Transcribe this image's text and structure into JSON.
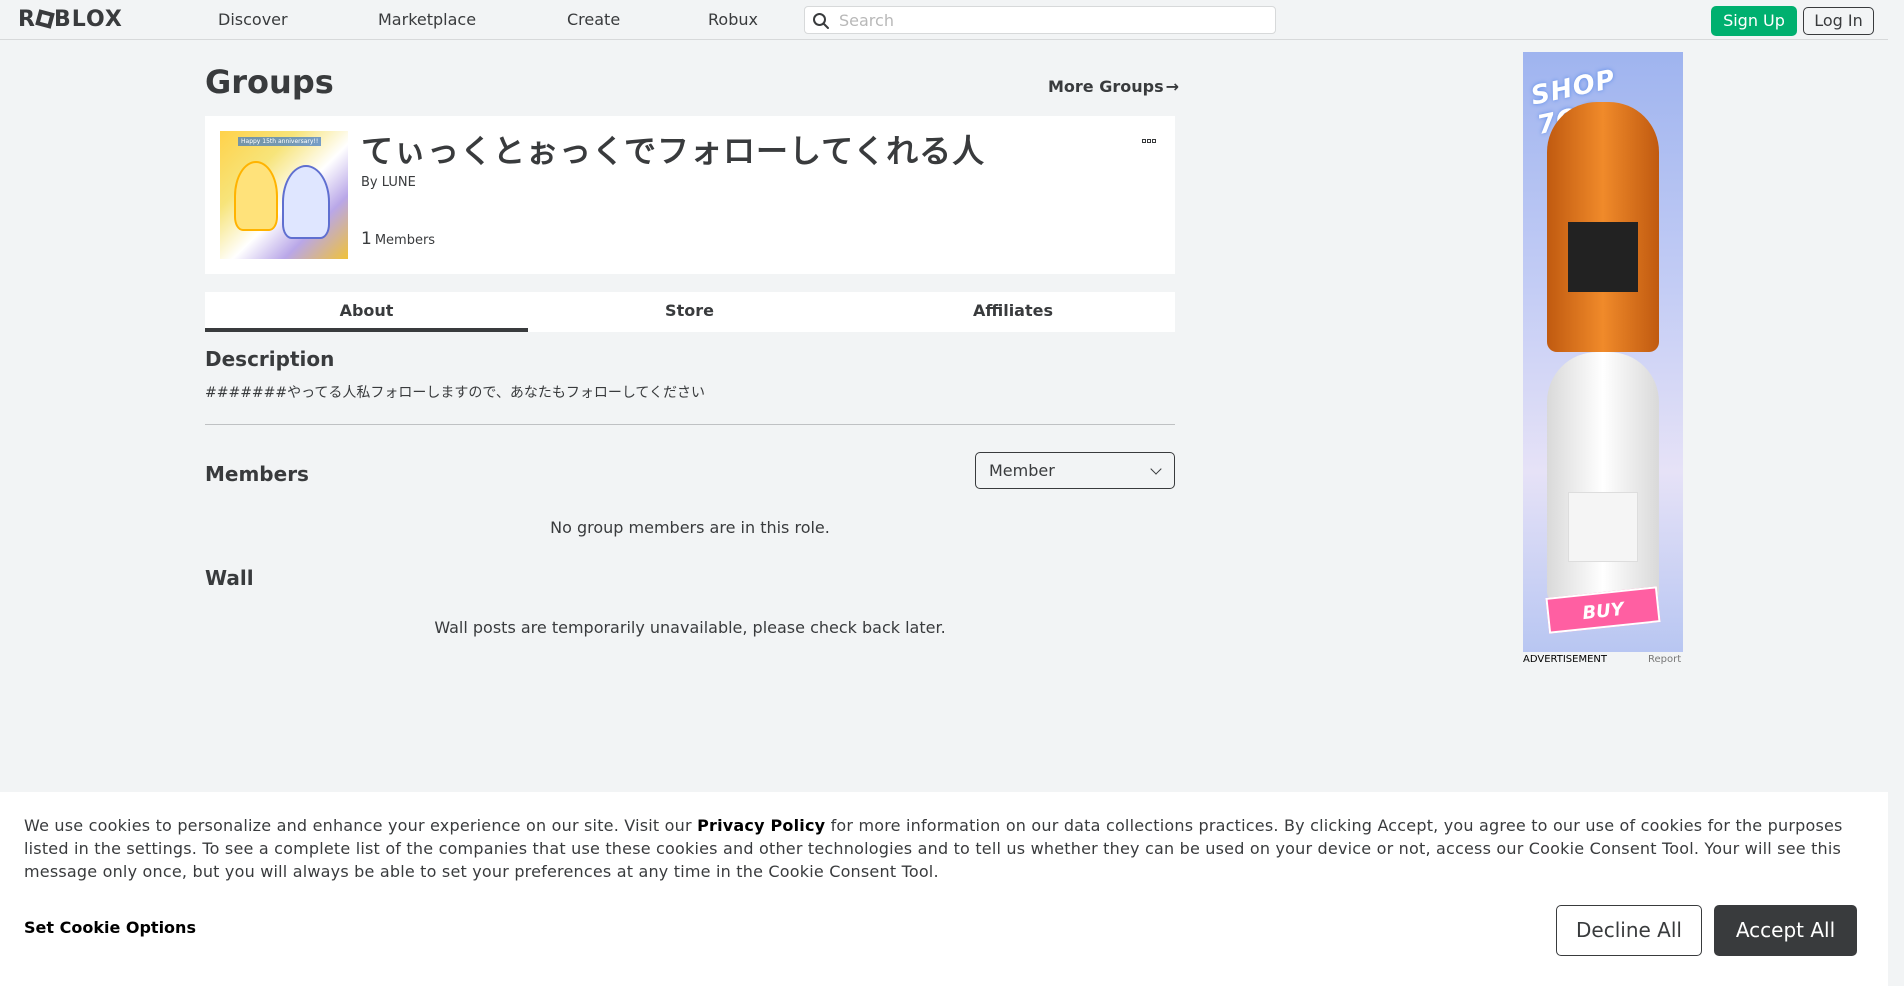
{
  "nav": {
    "logo": "ROBLOX",
    "links": [
      "Discover",
      "Marketplace",
      "Create",
      "Robux"
    ],
    "search_placeholder": "Search",
    "signup_label": "Sign Up",
    "login_label": "Log In"
  },
  "page": {
    "title": "Groups",
    "more_groups": "More Groups",
    "more_groups_arrow": "→"
  },
  "group": {
    "name": "てぃっくとぉっくでフォローしてくれる人",
    "owner_prefix": "By ",
    "owner": "LUNE",
    "member_count": "1",
    "member_label": "Members",
    "thumbnail_text": "Happy 15th anniversary!!"
  },
  "tabs": [
    {
      "label": "About",
      "active": true
    },
    {
      "label": "Store",
      "active": false
    },
    {
      "label": "Affiliates",
      "active": false
    }
  ],
  "about": {
    "description_title": "Description",
    "description": "#######やってる人私フォローしますので、あなたもフォローしてください",
    "members_title": "Members",
    "role_selected": "Member",
    "members_empty": "No group members are in this role.",
    "wall_title": "Wall",
    "wall_message": "Wall posts are temporarily unavailable, please check back later."
  },
  "ad": {
    "label": "ADVERTISEMENT",
    "report": "Report",
    "headline": "SHOP 7OO",
    "buy": "BUY"
  },
  "cookie": {
    "text_before": "We use cookies to personalize and enhance your experience on our site. Visit our ",
    "policy_link": "Privacy Policy",
    "text_after": " for more information on our data collections practices. By clicking Accept, you agree to our use of cookies for the purposes listed in the settings. To see a complete list of the companies that use these cookies and other technologies and to tell us whether they can be used on your device or not, access our Cookie Consent Tool. Your will see this message only once, but you will always be able to set your preferences at any time in the Cookie Consent Tool.",
    "options_label": "Set Cookie Options",
    "decline_label": "Decline All",
    "accept_label": "Accept All"
  },
  "colors": {
    "accent_green": "#00b06f",
    "text_dark": "#393b3d",
    "background": "#f2f4f5"
  }
}
